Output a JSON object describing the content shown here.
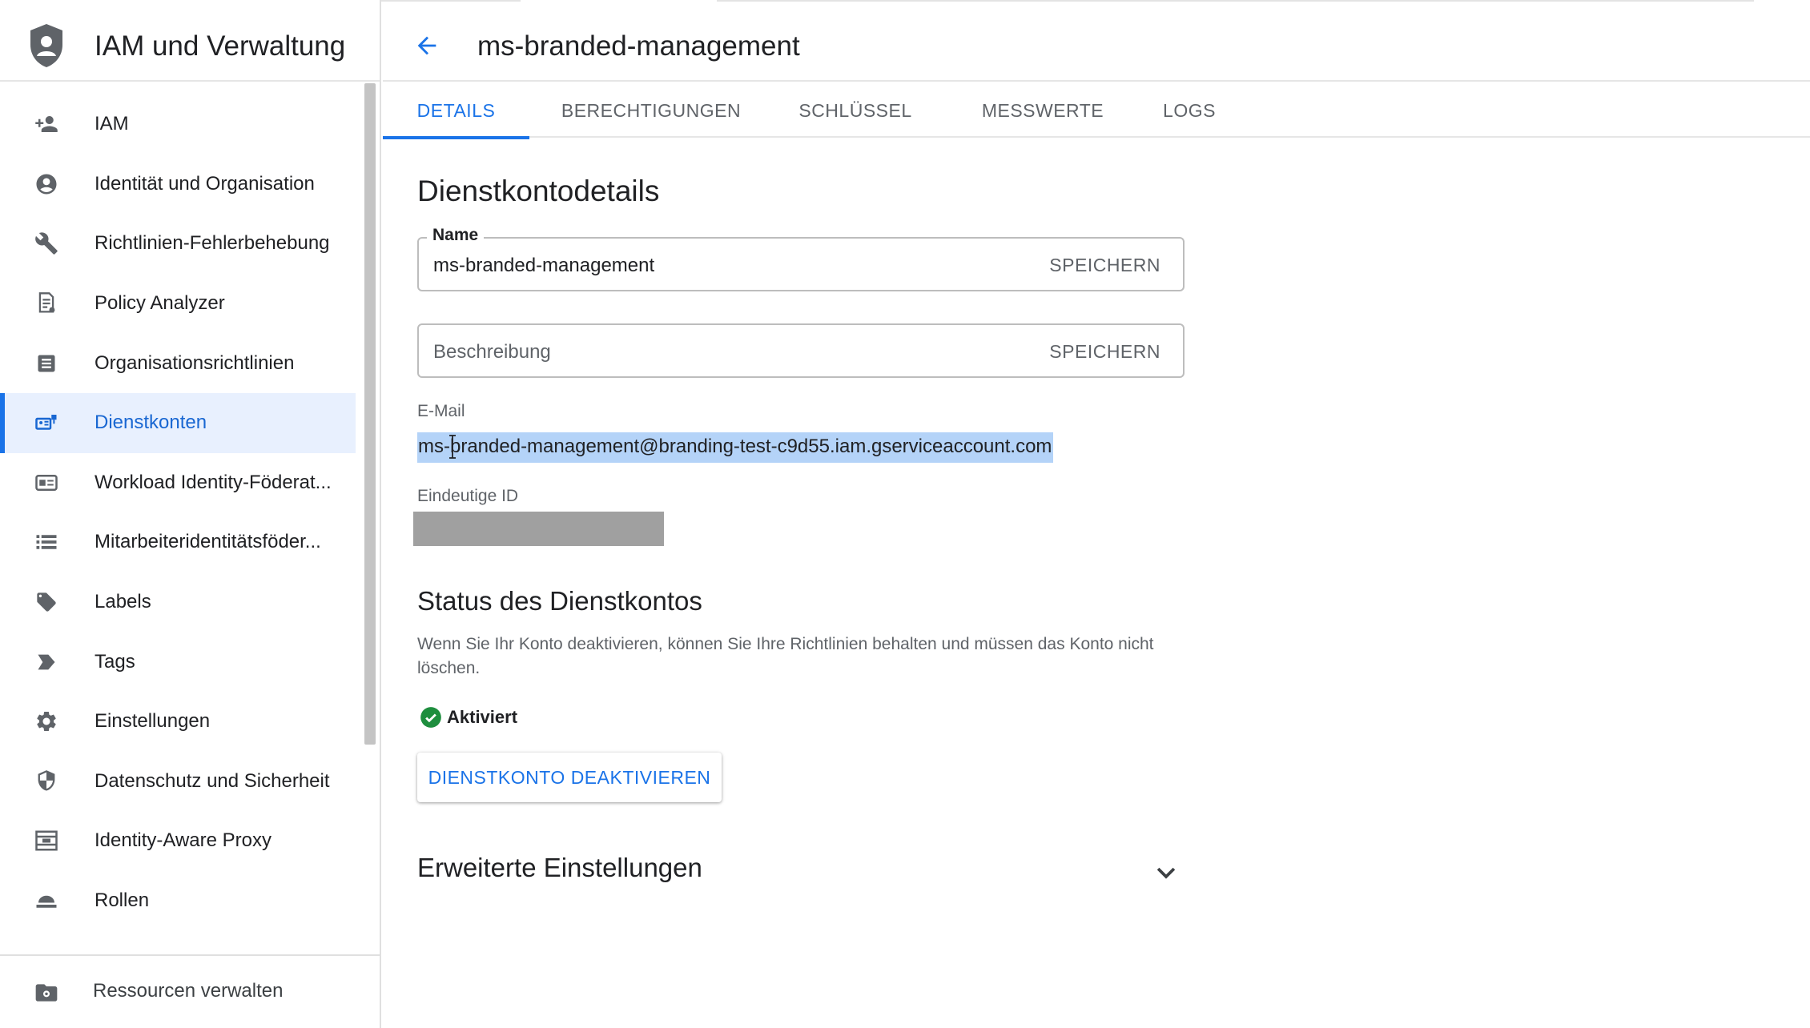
{
  "app": {
    "title": "IAM und Verwaltung"
  },
  "sidebar": {
    "items": [
      {
        "label": "IAM",
        "icon": "person-add-icon"
      },
      {
        "label": "Identität und Organisation",
        "icon": "account-circle-icon"
      },
      {
        "label": "Richtlinien-Fehlerbehebung",
        "icon": "wrench-icon"
      },
      {
        "label": "Policy Analyzer",
        "icon": "policy-document-icon"
      },
      {
        "label": "Organisationsrichtlinien",
        "icon": "list-document-icon"
      },
      {
        "label": "Dienstkonten",
        "icon": "service-account-icon",
        "active": true
      },
      {
        "label": "Workload Identity-Föderat...",
        "icon": "id-card-icon"
      },
      {
        "label": "Mitarbeiteridentitätsföder...",
        "icon": "list-icon"
      },
      {
        "label": "Labels",
        "icon": "label-tag-icon"
      },
      {
        "label": "Tags",
        "icon": "tag-arrow-icon"
      },
      {
        "label": "Einstellungen",
        "icon": "gear-icon"
      },
      {
        "label": "Datenschutz und Sicherheit",
        "icon": "shield-icon"
      },
      {
        "label": "Identity-Aware Proxy",
        "icon": "proxy-icon"
      },
      {
        "label": "Rollen",
        "icon": "roles-icon"
      }
    ],
    "footer": {
      "label": "Ressourcen verwalten",
      "icon": "folder-settings-icon"
    }
  },
  "header": {
    "title": "ms-branded-management"
  },
  "tabs": [
    {
      "label": "DETAILS",
      "active": true
    },
    {
      "label": "BERECHTIGUNGEN"
    },
    {
      "label": "SCHLÜSSEL"
    },
    {
      "label": "MESSWERTE"
    },
    {
      "label": "LOGS"
    }
  ],
  "details": {
    "heading": "Dienstkontodetails",
    "name_label": "Name",
    "name_value": "ms-branded-management",
    "save_label": "SPEICHERN",
    "description_placeholder": "Beschreibung",
    "email_label": "E-Mail",
    "email_value": "ms-branded-management@branding-test-c9d55.iam.gserviceaccount.com",
    "unique_id_label": "Eindeutige ID"
  },
  "status": {
    "heading": "Status des Dienstkontos",
    "description": "Wenn Sie Ihr Konto deaktivieren, können Sie Ihre Richtlinien behalten und müssen das Konto nicht löschen.",
    "state": "Aktiviert",
    "button": "DIENSTKONTO DEAKTIVIEREN"
  },
  "advanced": {
    "heading": "Erweiterte Einstellungen"
  },
  "colors": {
    "accent": "#1a73e8",
    "active_bg": "#e8f0fe",
    "success": "#1e8e3e",
    "selection": "#b4d3f8"
  }
}
